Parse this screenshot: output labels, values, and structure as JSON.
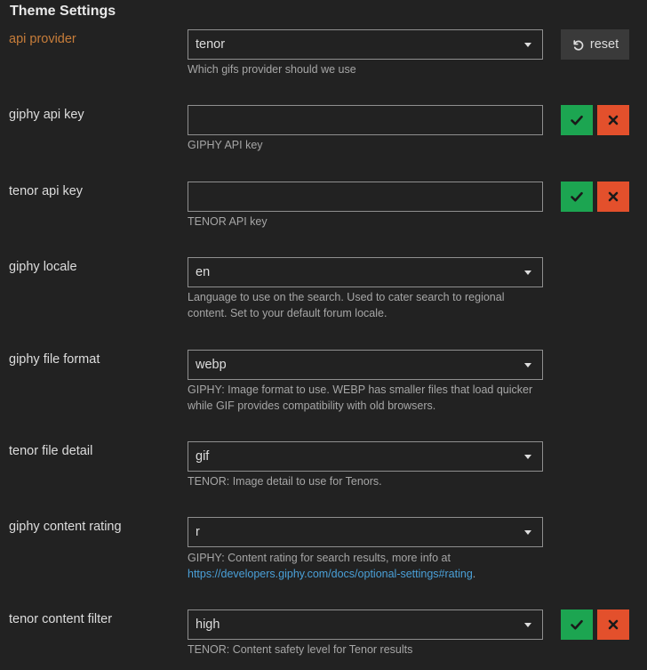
{
  "header": {
    "title": "Theme Settings"
  },
  "settings": {
    "api_provider": {
      "label": "api provider",
      "value": "tenor",
      "description": "Which gifs provider should we use",
      "reset_label": "reset"
    },
    "giphy_api_key": {
      "label": "giphy api key",
      "value": "",
      "description": "GIPHY API key"
    },
    "tenor_api_key": {
      "label": "tenor api key",
      "value": "",
      "description": "TENOR API key"
    },
    "giphy_locale": {
      "label": "giphy locale",
      "value": "en",
      "description": "Language to use on the search. Used to cater search to regional content. Set to your default forum locale."
    },
    "giphy_file_format": {
      "label": "giphy file format",
      "value": "webp",
      "description": "GIPHY: Image format to use. WEBP has smaller files that load quicker while GIF provides compatibility with old browsers."
    },
    "tenor_file_detail": {
      "label": "tenor file detail",
      "value": "gif",
      "description": "TENOR: Image detail to use for Tenors."
    },
    "giphy_content_rating": {
      "label": "giphy content rating",
      "value": "r",
      "description_prefix": "GIPHY: Content rating for search results, more info at",
      "link": "https://developers.giphy.com/docs/optional-settings#rating",
      "description_suffix": "."
    },
    "tenor_content_filter": {
      "label": "tenor content filter",
      "value": "high",
      "description": "TENOR: Content safety level for Tenor results"
    }
  },
  "icons": {
    "ok": "checkmark-icon",
    "cancel": "close-icon",
    "reset": "undo-icon"
  },
  "colors": {
    "background": "#222222",
    "overridden_label": "#c77d3a",
    "ok_button": "#1ca551",
    "cancel_button": "#e3502c",
    "link": "#4aa0d8"
  }
}
